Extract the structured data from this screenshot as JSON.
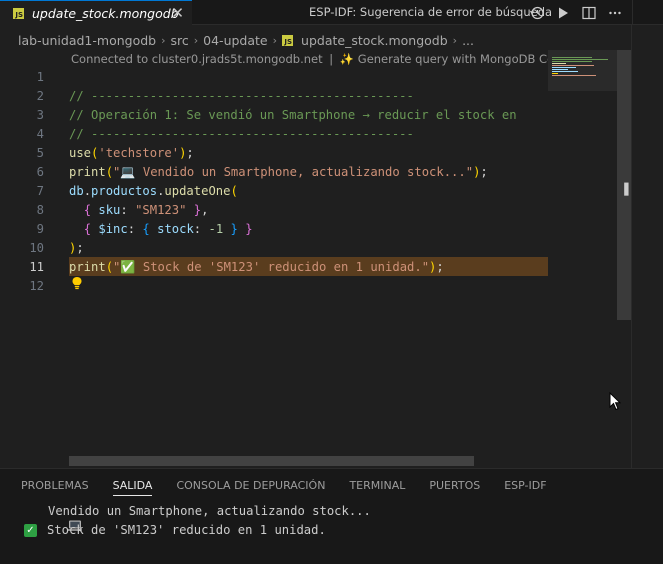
{
  "tab": {
    "title": "update_stock.mongodb",
    "badge": "JS",
    "close": "✕"
  },
  "window": {
    "title": "ESP-IDF: Sugerencia de error de búsqueda"
  },
  "breadcrumb": {
    "items": [
      "lab-unidad1-mongodb",
      "src",
      "04-update",
      "update_stock.mongodb",
      "..."
    ],
    "separator": "›"
  },
  "codelens": {
    "connection": "Connected to cluster0.jrads5t.mongodb.net",
    "divider": "|",
    "copilot": "Generate query with MongoDB Copilot"
  },
  "editor": {
    "line_numbers": [
      "1",
      "2",
      "3",
      "4",
      "5",
      "6",
      "7",
      "8",
      "9",
      "10",
      "11",
      "12"
    ],
    "active_line": 11,
    "lines": [
      [],
      [
        [
          "c-comment",
          "// --------------------------------------------"
        ]
      ],
      [
        [
          "c-comment",
          "// Operación 1: Se vendió un Smartphone → reducir el stock en"
        ]
      ],
      [
        [
          "c-comment",
          "// --------------------------------------------"
        ]
      ],
      [
        [
          "c-ident",
          "use"
        ],
        [
          "c-bracket1",
          "("
        ],
        [
          "c-str",
          "'techstore'"
        ],
        [
          "c-bracket1",
          ")"
        ],
        [
          "c-plain",
          ";"
        ]
      ],
      [
        [
          "c-ident",
          "print"
        ],
        [
          "c-bracket1",
          "("
        ],
        [
          "c-str",
          "\"💻 Vendido un Smartphone, actualizando stock...\""
        ],
        [
          "c-bracket1",
          ")"
        ],
        [
          "c-plain",
          ";"
        ]
      ],
      [
        [
          "c-var",
          "db"
        ],
        [
          "c-plain",
          "."
        ],
        [
          "c-var",
          "productos"
        ],
        [
          "c-plain",
          "."
        ],
        [
          "c-ident",
          "updateOne"
        ],
        [
          "c-bracket1",
          "("
        ]
      ],
      [
        [
          "c-plain",
          "  "
        ],
        [
          "c-bracket2",
          "{"
        ],
        [
          "c-plain",
          " "
        ],
        [
          "c-prop",
          "sku"
        ],
        [
          "c-plain",
          ": "
        ],
        [
          "c-str",
          "\"SM123\""
        ],
        [
          "c-plain",
          " "
        ],
        [
          "c-bracket2",
          "}"
        ],
        [
          "c-plain",
          ","
        ]
      ],
      [
        [
          "c-plain",
          "  "
        ],
        [
          "c-bracket2",
          "{"
        ],
        [
          "c-plain",
          " "
        ],
        [
          "c-prop",
          "$inc"
        ],
        [
          "c-plain",
          ": "
        ],
        [
          "c-bracket3",
          "{"
        ],
        [
          "c-plain",
          " "
        ],
        [
          "c-prop",
          "stock"
        ],
        [
          "c-plain",
          ": "
        ],
        [
          "c-num",
          "-1"
        ],
        [
          "c-plain",
          " "
        ],
        [
          "c-bracket3",
          "}"
        ],
        [
          "c-plain",
          " "
        ],
        [
          "c-bracket2",
          "}"
        ]
      ],
      [
        [
          "c-bracket1",
          ")"
        ],
        [
          "c-plain",
          ";"
        ]
      ],
      [
        [
          "c-ident",
          "print"
        ],
        [
          "c-bracket1",
          "("
        ],
        [
          "c-str",
          "\"✅ Stock de 'SM123' reducido en 1 unidad.\""
        ],
        [
          "c-bracket1",
          ")"
        ],
        [
          "c-plain",
          ";"
        ]
      ],
      []
    ]
  },
  "panel": {
    "tabs": [
      "PROBLEMAS",
      "SALIDA",
      "CONSOLA DE DEPURACIÓN",
      "TERMINAL",
      "PUERTOS",
      "ESP-IDF"
    ],
    "active_tab": "SALIDA",
    "output": [
      "Vendido un Smartphone, actualizando stock...",
      "Stock de 'SM123' reducido en 1 unidad."
    ]
  },
  "icons": {
    "titlebar": [
      "history-icon",
      "run-icon",
      "split-editor-icon",
      "more-actions-icon"
    ],
    "codelens_sparkle": "sparkle-icon",
    "lightbulb": "lightbulb-icon"
  },
  "colors": {
    "accent": "#0078d4",
    "active_line_bg": "#5a3d1e",
    "comment": "#6a9955",
    "string": "#ce9178",
    "function": "#dcdcaa",
    "variable": "#9cdcfe"
  }
}
